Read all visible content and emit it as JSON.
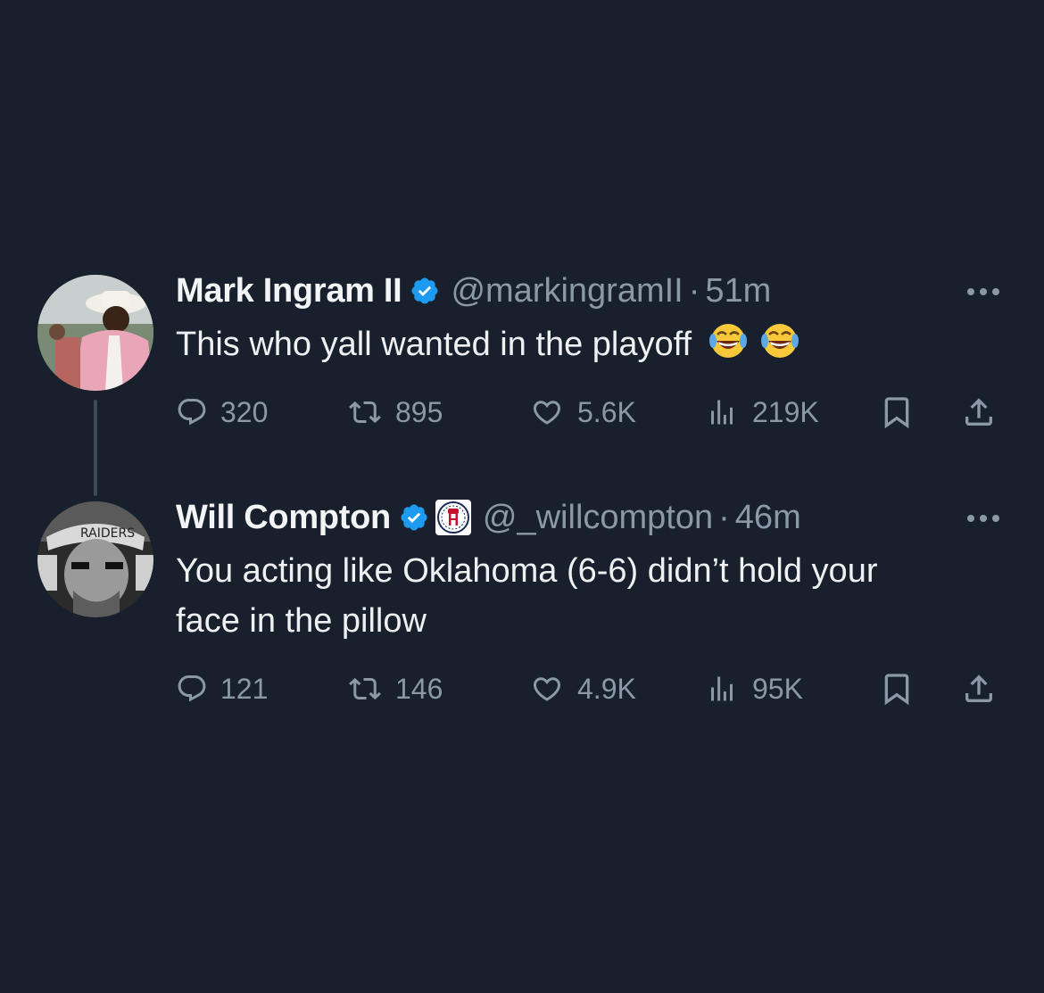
{
  "tweets": [
    {
      "display_name": "Mark Ingram II",
      "handle": "@markingramII",
      "separator": "·",
      "time": "51m",
      "text": "This who yall wanted in the playoff",
      "emoji": [
        "😂",
        "😂"
      ],
      "verified": true,
      "affiliation_badge": false,
      "actions": {
        "replies": "320",
        "reposts": "895",
        "likes": "5.6K",
        "views": "219K"
      }
    },
    {
      "display_name": "Will Compton",
      "handle": "@_willcompton",
      "separator": "·",
      "time": "46m",
      "text": "You acting like Oklahoma (6-6) didn’t hold your face in the pillow",
      "verified": true,
      "affiliation_badge": true,
      "actions": {
        "replies": "121",
        "reposts": "146",
        "likes": "4.9K",
        "views": "95K"
      }
    }
  ],
  "colors": {
    "background": "#17202c",
    "muted_text": "#8b98a5",
    "verified_blue": "#1d9bf0"
  },
  "icons": [
    "reply-icon",
    "repost-icon",
    "like-icon",
    "views-icon",
    "bookmark-icon",
    "share-icon",
    "more-icon",
    "verified-badge-icon"
  ]
}
